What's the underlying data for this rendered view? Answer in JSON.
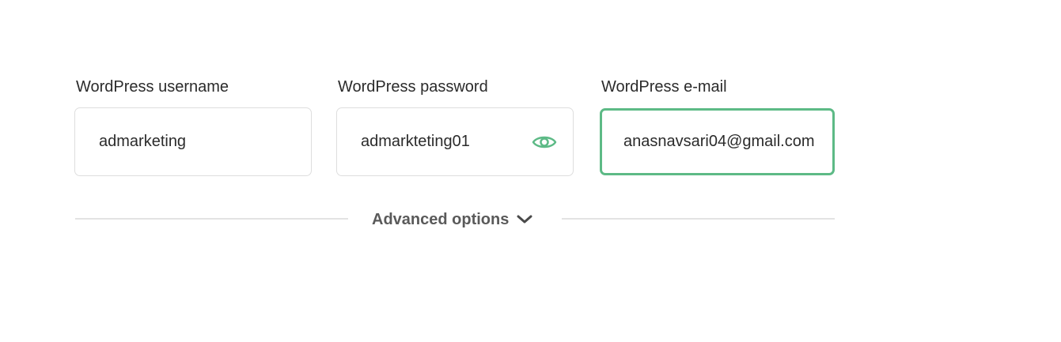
{
  "form": {
    "username": {
      "label": "WordPress username",
      "value": "admarketing"
    },
    "password": {
      "label": "WordPress password",
      "value": "admarkteting01",
      "toggle_icon": "eye-icon"
    },
    "email": {
      "label": "WordPress e-mail",
      "value": "anasnavsari04@gmail.com",
      "focused": true
    }
  },
  "advanced": {
    "label": "Advanced options",
    "icon": "chevron-down-icon"
  },
  "colors": {
    "accent": "#5dba86",
    "border": "#dedede",
    "text": "#2b2b2b",
    "muted": "#5a5a5a",
    "divider": "#e3e3e3"
  }
}
